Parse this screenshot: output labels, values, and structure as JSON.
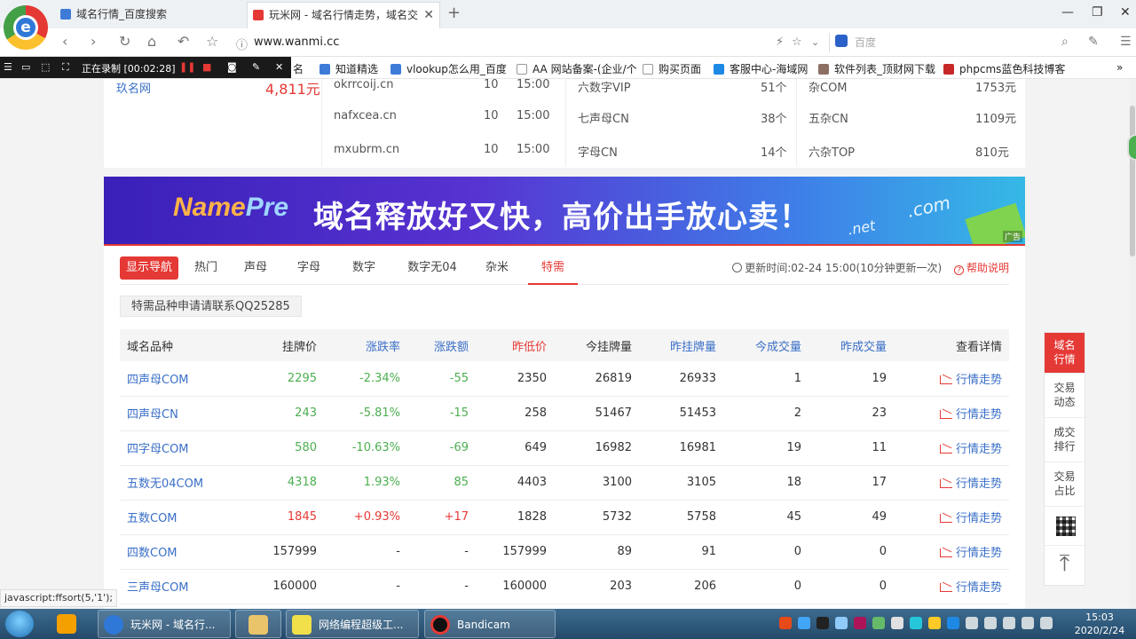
{
  "browser": {
    "tabs": [
      {
        "title": "域名行情_百度搜索"
      },
      {
        "title": "玩米网 - 域名行情走势，域名交"
      }
    ],
    "url": "www.wanmi.cc",
    "search_placeholder": "百度"
  },
  "recorder": {
    "status": "正在录制 [00:02:28]"
  },
  "bookmarks": [
    "名",
    "知道精选",
    "vlookup怎么用_百度",
    "AA 网站备案-(企业/个",
    "购买页面",
    "客服中心-海域网",
    "软件列表_顶财网下载",
    "phpcms蓝色科技博客"
  ],
  "top_card": {
    "left": {
      "label": "玖名网",
      "price": "4,811元"
    },
    "rows": [
      {
        "domain": "okrrcoij.cn",
        "n": "10",
        "time": "15:00",
        "cat": "六数字VIP",
        "cnt": "51个",
        "cat2": "杂COM",
        "price2": "1753元"
      },
      {
        "domain": "nafxcea.cn",
        "n": "10",
        "time": "15:00",
        "cat": "七声母CN",
        "cnt": "38个",
        "cat2": "五杂CN",
        "price2": "1109元"
      },
      {
        "domain": "mxubrm.cn",
        "n": "10",
        "time": "15:00",
        "cat": "字母CN",
        "cnt": "14个",
        "cat2": "六杂TOP",
        "price2": "810元"
      }
    ]
  },
  "banner": {
    "brand_a": "Name",
    "brand_b": "Pre",
    "slogan": "域名释放好又快，高价出手放心卖！",
    "com": ".com",
    "net": ".net",
    "ad": "广告"
  },
  "filters": {
    "nav_button": "显示导航",
    "items": [
      "热门",
      "声母",
      "字母",
      "数字",
      "数字无04",
      "杂米",
      "特需"
    ],
    "active": "特需",
    "update_text": "更新时间:02-24 15:00(10分钟更新一次)",
    "help": "帮助说明"
  },
  "notice": "特需品种申请请联系QQ25285",
  "table": {
    "headers": [
      "域名品种",
      "挂牌价",
      "涨跌率",
      "涨跌额",
      "昨低价",
      "今挂牌量",
      "昨挂牌量",
      "今成交量",
      "昨成交量",
      "查看详情"
    ],
    "trend_label": "行情走势",
    "rows": [
      {
        "name": "四声母COM",
        "price": "2295",
        "rate": "-2.34%",
        "amount": "-55",
        "low": "2350",
        "today": "26819",
        "yday": "26933",
        "tdeal": "1",
        "ydeal": "19",
        "dir": "down"
      },
      {
        "name": "四声母CN",
        "price": "243",
        "rate": "-5.81%",
        "amount": "-15",
        "low": "258",
        "today": "51467",
        "yday": "51453",
        "tdeal": "2",
        "ydeal": "23",
        "dir": "down"
      },
      {
        "name": "四字母COM",
        "price": "580",
        "rate": "-10.63%",
        "amount": "-69",
        "low": "649",
        "today": "16982",
        "yday": "16981",
        "tdeal": "19",
        "ydeal": "11",
        "dir": "down"
      },
      {
        "name": "五数无04COM",
        "price": "4318",
        "rate": "1.93%",
        "amount": "85",
        "low": "4403",
        "today": "3100",
        "yday": "3105",
        "tdeal": "18",
        "ydeal": "17",
        "dir": "down"
      },
      {
        "name": "五数COM",
        "price": "1845",
        "rate": "+0.93%",
        "amount": "+17",
        "low": "1828",
        "today": "5732",
        "yday": "5758",
        "tdeal": "45",
        "ydeal": "49",
        "dir": "up"
      },
      {
        "name": "四数COM",
        "price": "157999",
        "rate": "-",
        "amount": "-",
        "low": "157999",
        "today": "89",
        "yday": "91",
        "tdeal": "0",
        "ydeal": "0",
        "dir": "flat"
      },
      {
        "name": "三声母COM",
        "price": "160000",
        "rate": "-",
        "amount": "-",
        "low": "160000",
        "today": "203",
        "yday": "206",
        "tdeal": "0",
        "ydeal": "0",
        "dir": "flat"
      }
    ]
  },
  "sidebar": {
    "items": [
      "域名\n行情",
      "交易\n动态",
      "成交\n排行",
      "交易\n占比"
    ]
  },
  "statusbar": "javascript:ffsort(5,'1');",
  "taskbar": {
    "items": [
      "玩米网 - 域名行...",
      "",
      "网络编程超级工...",
      "Bandicam"
    ],
    "time": "15:03",
    "date": "2020/2/24"
  },
  "colors": {
    "accent": "#e53935",
    "link": "#3a6fc7",
    "green": "#4caf50"
  }
}
